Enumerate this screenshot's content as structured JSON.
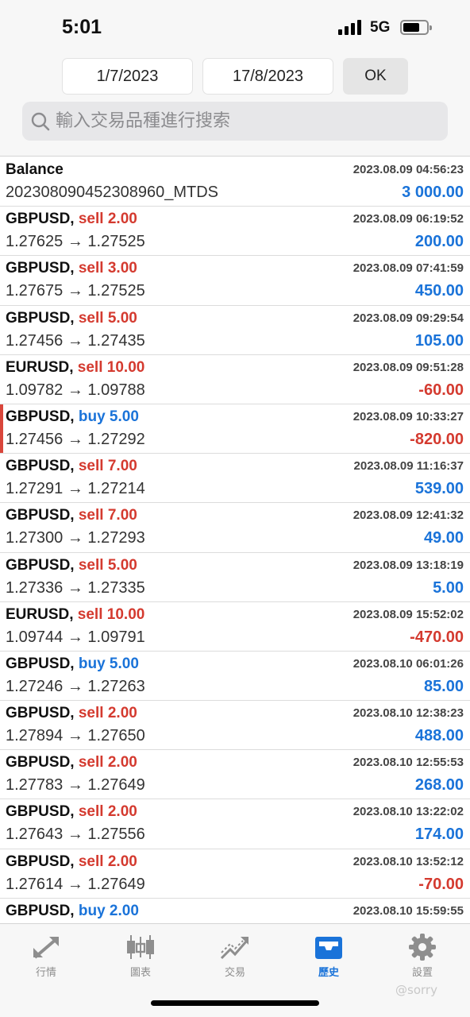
{
  "status_bar": {
    "time": "5:01",
    "network": "5G"
  },
  "filter": {
    "date_from": "1/7/2023",
    "date_to": "17/8/2023",
    "ok_label": "OK",
    "search_placeholder": "輸入交易品種進行搜索"
  },
  "records": [
    {
      "symbol": "Balance",
      "side": "",
      "volume": "",
      "datetime": "2023.08.09 04:56:23",
      "detail": "202308090452308960_MTDS",
      "profit": "3 000.00",
      "profit_color": "#1a73d9"
    },
    {
      "symbol": "GBPUSD,",
      "side": "sell",
      "volume": "2.00",
      "datetime": "2023.08.09 06:19:52",
      "detail": "1.27625 → 1.27525",
      "profit": "200.00",
      "profit_color": "#1a73d9"
    },
    {
      "symbol": "GBPUSD,",
      "side": "sell",
      "volume": "3.00",
      "datetime": "2023.08.09 07:41:59",
      "detail": "1.27675 → 1.27525",
      "profit": "450.00",
      "profit_color": "#1a73d9"
    },
    {
      "symbol": "GBPUSD,",
      "side": "sell",
      "volume": "5.00",
      "datetime": "2023.08.09 09:29:54",
      "detail": "1.27456 → 1.27435",
      "profit": "105.00",
      "profit_color": "#1a73d9"
    },
    {
      "symbol": "EURUSD,",
      "side": "sell",
      "volume": "10.00",
      "datetime": "2023.08.09 09:51:28",
      "detail": "1.09782 → 1.09788",
      "profit": "-60.00",
      "profit_color": "#d43a2f"
    },
    {
      "symbol": "GBPUSD,",
      "side": "buy",
      "volume": "5.00",
      "datetime": "2023.08.09 10:33:27",
      "detail": "1.27456 → 1.27292",
      "profit": "-820.00",
      "profit_color": "#d43a2f"
    },
    {
      "symbol": "GBPUSD,",
      "side": "sell",
      "volume": "7.00",
      "datetime": "2023.08.09 11:16:37",
      "detail": "1.27291 → 1.27214",
      "profit": "539.00",
      "profit_color": "#1a73d9"
    },
    {
      "symbol": "GBPUSD,",
      "side": "sell",
      "volume": "7.00",
      "datetime": "2023.08.09 12:41:32",
      "detail": "1.27300 → 1.27293",
      "profit": "49.00",
      "profit_color": "#1a73d9"
    },
    {
      "symbol": "GBPUSD,",
      "side": "sell",
      "volume": "5.00",
      "datetime": "2023.08.09 13:18:19",
      "detail": "1.27336 → 1.27335",
      "profit": "5.00",
      "profit_color": "#1a73d9"
    },
    {
      "symbol": "EURUSD,",
      "side": "sell",
      "volume": "10.00",
      "datetime": "2023.08.09 15:52:02",
      "detail": "1.09744 → 1.09791",
      "profit": "-470.00",
      "profit_color": "#d43a2f"
    },
    {
      "symbol": "GBPUSD,",
      "side": "buy",
      "volume": "5.00",
      "datetime": "2023.08.10 06:01:26",
      "detail": "1.27246 → 1.27263",
      "profit": "85.00",
      "profit_color": "#1a73d9"
    },
    {
      "symbol": "GBPUSD,",
      "side": "sell",
      "volume": "2.00",
      "datetime": "2023.08.10 12:38:23",
      "detail": "1.27894 → 1.27650",
      "profit": "488.00",
      "profit_color": "#1a73d9"
    },
    {
      "symbol": "GBPUSD,",
      "side": "sell",
      "volume": "2.00",
      "datetime": "2023.08.10 12:55:53",
      "detail": "1.27783 → 1.27649",
      "profit": "268.00",
      "profit_color": "#1a73d9"
    },
    {
      "symbol": "GBPUSD,",
      "side": "sell",
      "volume": "2.00",
      "datetime": "2023.08.10 13:22:02",
      "detail": "1.27643 → 1.27556",
      "profit": "174.00",
      "profit_color": "#1a73d9"
    },
    {
      "symbol": "GBPUSD,",
      "side": "sell",
      "volume": "2.00",
      "datetime": "2023.08.10 13:52:12",
      "detail": "1.27614 → 1.27649",
      "profit": "-70.00",
      "profit_color": "#d43a2f"
    },
    {
      "symbol": "GBPUSD,",
      "side": "buy",
      "volume": "2.00",
      "datetime": "2023.08.10 15:59:55",
      "detail": "",
      "profit": "",
      "profit_color": "#1a73d9"
    }
  ],
  "tabs": [
    {
      "label": "行情",
      "icon": "quotes-icon",
      "active": false
    },
    {
      "label": "圖表",
      "icon": "chart-icon",
      "active": false
    },
    {
      "label": "交易",
      "icon": "trade-icon",
      "active": false
    },
    {
      "label": "歷史",
      "icon": "history-icon",
      "active": true
    },
    {
      "label": "設置",
      "icon": "settings-icon",
      "active": false
    }
  ],
  "colors": {
    "accent": "#1a73d9",
    "sell": "#d43a2f",
    "buy": "#1a73d9"
  },
  "watermark": "@sorry"
}
